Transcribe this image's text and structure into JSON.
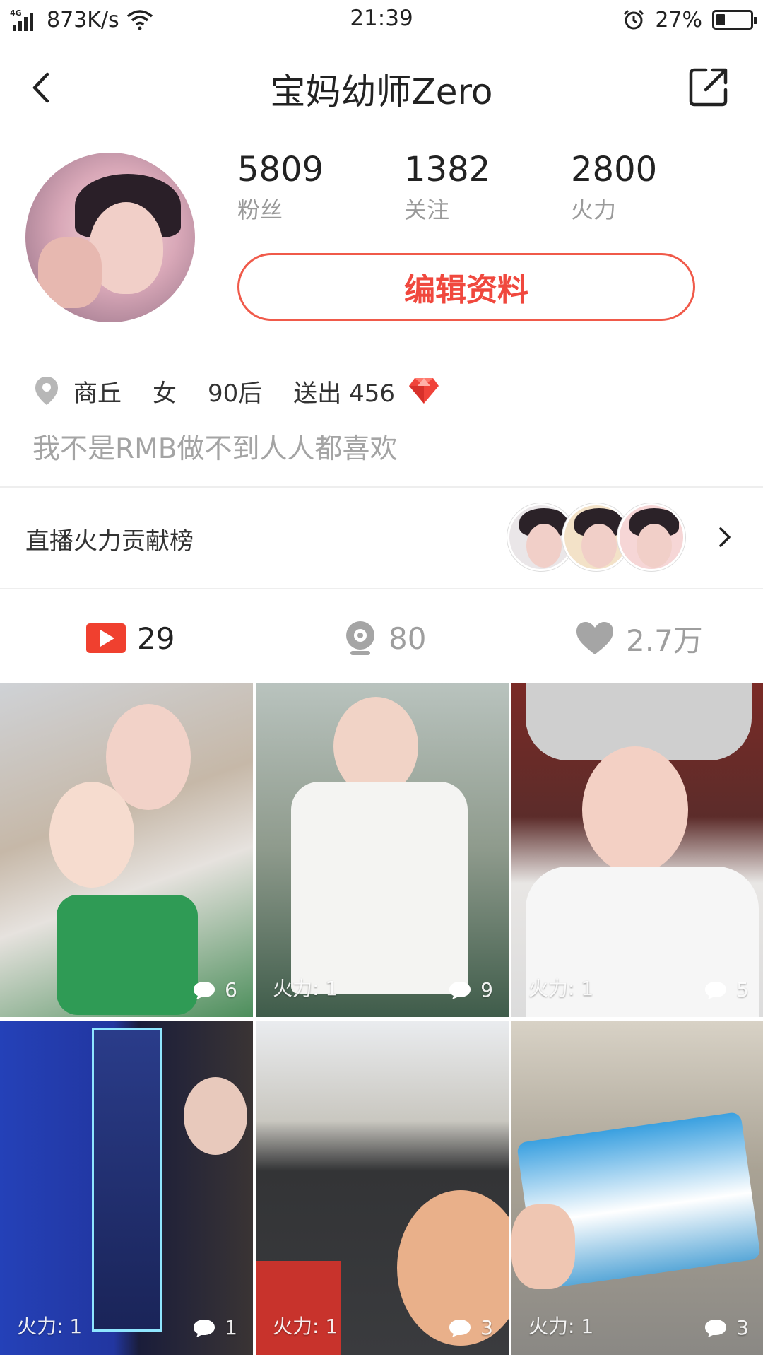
{
  "status_bar": {
    "network": "4G",
    "speed": "873K/s",
    "time": "21:39",
    "battery": "27%",
    "battery_level": 0.27
  },
  "header": {
    "title": "宝妈幼师Zero"
  },
  "profile": {
    "stats": [
      {
        "value": "5809",
        "label": "粉丝"
      },
      {
        "value": "1382",
        "label": "关注"
      },
      {
        "value": "2800",
        "label": "火力"
      }
    ],
    "edit_label": "编辑资料",
    "location": "商丘",
    "gender": "女",
    "age_group": "90后",
    "gift_text": "送出 456",
    "bio": "我不是RMB做不到人人都喜欢"
  },
  "contribution": {
    "label": "直播火力贡献榜"
  },
  "tabs": [
    {
      "count": "29",
      "icon": "video-play-icon"
    },
    {
      "count": "80",
      "icon": "webcam-icon"
    },
    {
      "count": "2.7万",
      "icon": "heart-icon"
    }
  ],
  "videos": [
    {
      "heat": "",
      "comments": "6"
    },
    {
      "heat": "火力: 1",
      "comments": "9"
    },
    {
      "heat": "火力: 1",
      "comments": "5"
    },
    {
      "heat": "火力: 1",
      "comments": "1"
    },
    {
      "heat": "火力: 1",
      "comments": "3"
    },
    {
      "heat": "火力: 1",
      "comments": "3"
    }
  ],
  "colors": {
    "accent": "#f0483e",
    "muted": "#9e9e9e"
  }
}
